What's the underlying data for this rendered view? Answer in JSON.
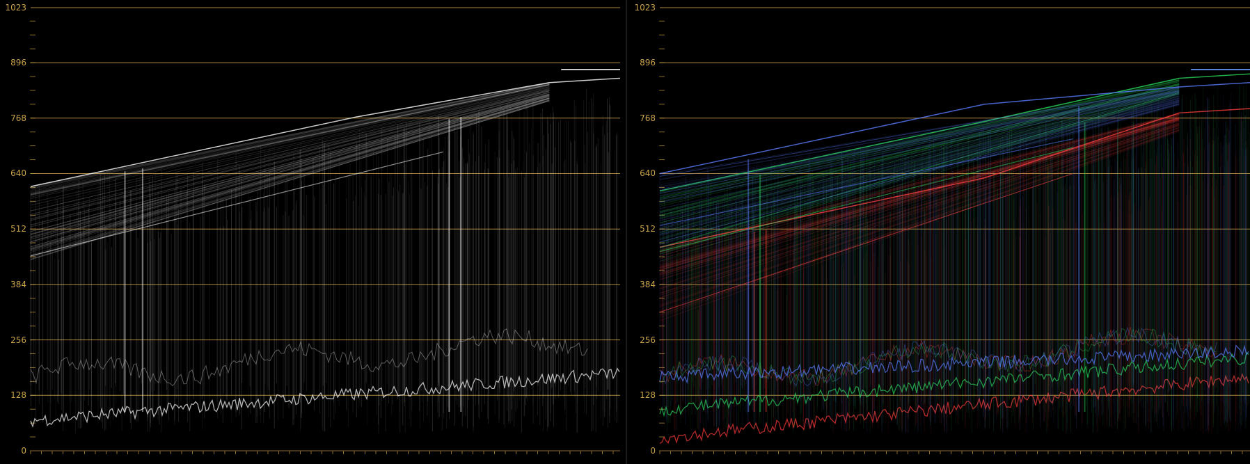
{
  "scale_labels": [
    "1023",
    "896",
    "768",
    "640",
    "512",
    "384",
    "256",
    "128",
    "0"
  ],
  "colors": {
    "graticule": "#c9a24a",
    "tick": "#8a6d2e",
    "background": "#000000",
    "luma_trace": "#ffffff",
    "red_trace": "#ff3b3b",
    "green_trace": "#2bd65b",
    "blue_trace": "#5a7cff"
  },
  "panels": [
    {
      "name": "luma-waveform",
      "mode": "luma"
    },
    {
      "name": "rgb-parade-overlay",
      "mode": "rgb"
    }
  ]
}
